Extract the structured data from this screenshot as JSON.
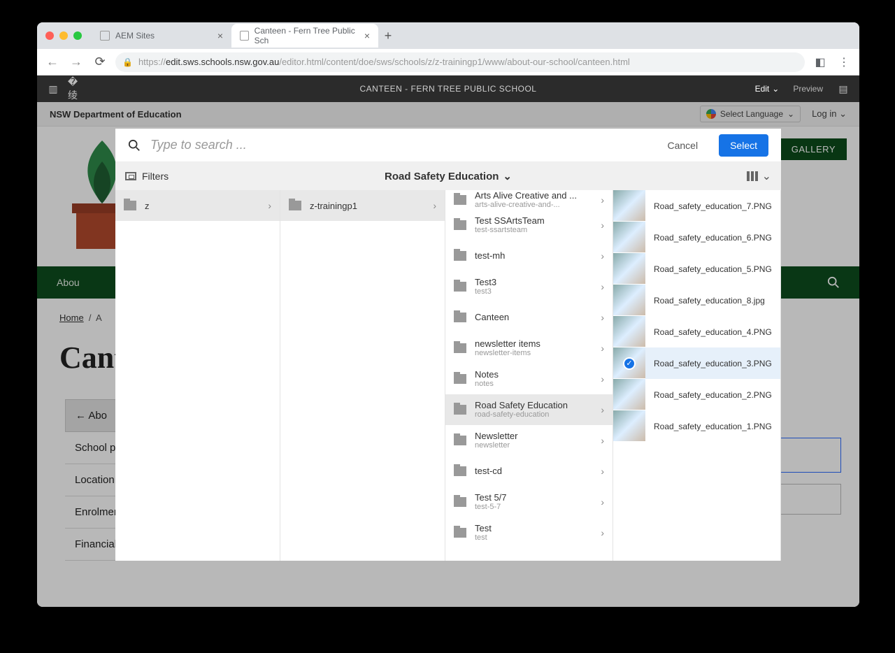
{
  "tabs": [
    {
      "title": "AEM Sites",
      "active": false
    },
    {
      "title": "Canteen - Fern Tree Public Sch",
      "active": true
    }
  ],
  "url": {
    "host": "edit.sws.schools.nsw.gov.au",
    "path": "/editor.html/content/doe/sws/schools/z/z-trainingp1/www/about-our-school/canteen.html"
  },
  "aem": {
    "title": "CANTEEN - FERN TREE PUBLIC SCHOOL",
    "edit": "Edit",
    "preview": "Preview"
  },
  "edbar": {
    "dept": "NSW Department of Education",
    "lang": "Select Language",
    "login": "Log in"
  },
  "gallery": "GALLERY",
  "navAbout": "Abou",
  "crumbs": {
    "home": "Home",
    "about": "A"
  },
  "pageTitle": "Cant",
  "sideItems": [
    "← Abo",
    "School p",
    "Location",
    "Enrolment",
    "Financial contributions and"
  ],
  "modal": {
    "search_placeholder": "Type to search ...",
    "cancel": "Cancel",
    "select": "Select",
    "filters": "Filters",
    "crumbTitle": "Road Safety Education",
    "col1": [
      {
        "title": "z"
      }
    ],
    "col2": [
      {
        "title": "z-trainingp1"
      }
    ],
    "col3": [
      {
        "title": "Arts Alive Creative and ...",
        "sub": "arts-alive-creative-and-...",
        "clip": true
      },
      {
        "title": "Test SSArtsTeam",
        "sub": "test-ssartsteam"
      },
      {
        "title": "test-mh",
        "sub": ""
      },
      {
        "title": "Test3",
        "sub": "test3"
      },
      {
        "title": "Canteen",
        "sub": ""
      },
      {
        "title": "newsletter items",
        "sub": "newsletter-items"
      },
      {
        "title": "Notes",
        "sub": "notes"
      },
      {
        "title": "Road Safety Education",
        "sub": "road-safety-education",
        "selected": true
      },
      {
        "title": "Newsletter",
        "sub": "newsletter"
      },
      {
        "title": "test-cd",
        "sub": ""
      },
      {
        "title": "Test 5/7",
        "sub": "test-5-7"
      },
      {
        "title": "Test",
        "sub": "test"
      }
    ],
    "col4": [
      {
        "name": "Road_safety_education_7.PNG"
      },
      {
        "name": "Road_safety_education_6.PNG"
      },
      {
        "name": "Road_safety_education_5.PNG"
      },
      {
        "name": "Road_safety_education_8.jpg"
      },
      {
        "name": "Road_safety_education_4.PNG"
      },
      {
        "name": "Road_safety_education_3.PNG",
        "selected": true
      },
      {
        "name": "Road_safety_education_2.PNG"
      },
      {
        "name": "Road_safety_education_1.PNG"
      }
    ]
  }
}
